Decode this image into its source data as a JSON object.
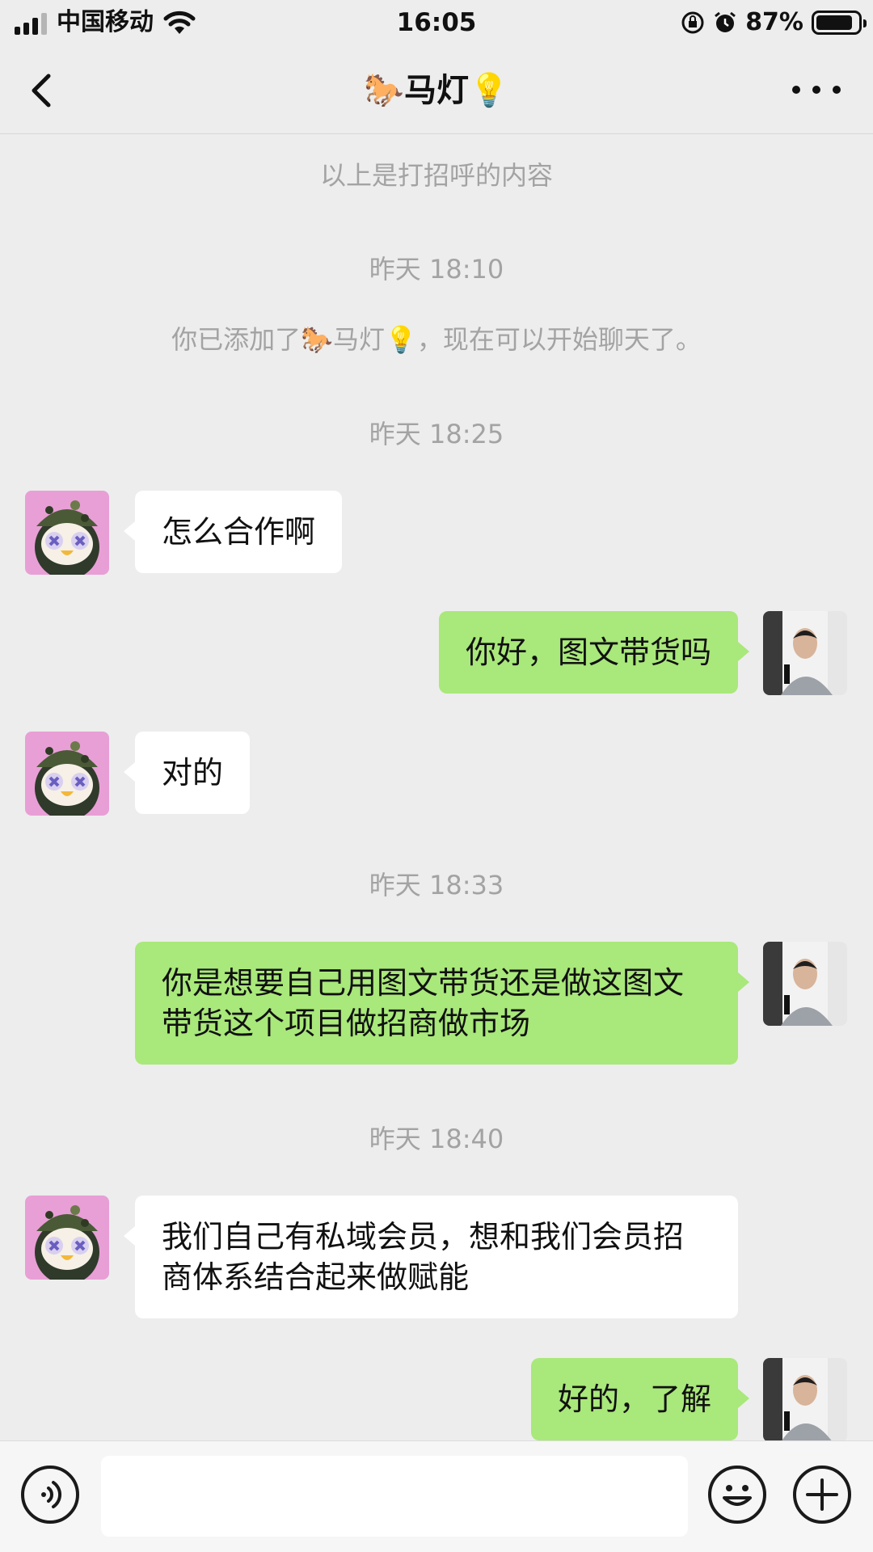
{
  "status_bar": {
    "carrier": "中国移动",
    "time": "16:05",
    "battery": "87%",
    "battery_level": 0.87
  },
  "nav": {
    "title": "🐎马灯💡"
  },
  "messages": {
    "greeting_note": "以上是打招呼的内容",
    "time_1": "昨天 18:10",
    "added_note": "你已添加了🐎马灯💡，现在可以开始聊天了。",
    "time_2": "昨天 18:25",
    "msg_1": "怎么合作啊",
    "msg_2": "你好，图文带货吗",
    "msg_3": "对的",
    "time_3": "昨天 18:33",
    "msg_4": "你是想要自己用图文带货还是做这图文带货这个项目做招商做市场",
    "time_4": "昨天 18:40",
    "msg_5": "我们自己有私域会员，想和我们会员招商体系结合起来做赋能",
    "msg_6": "好的，了解"
  },
  "colors": {
    "background": "#ededed",
    "bubble_self": "#a9e87a",
    "bubble_other": "#ffffff",
    "system_text": "#a3a3a3"
  },
  "icons": {
    "back": "chevron-left-icon",
    "more": "more-dots-icon",
    "voice": "voice-icon",
    "emoji": "emoji-icon",
    "plus": "plus-icon"
  }
}
